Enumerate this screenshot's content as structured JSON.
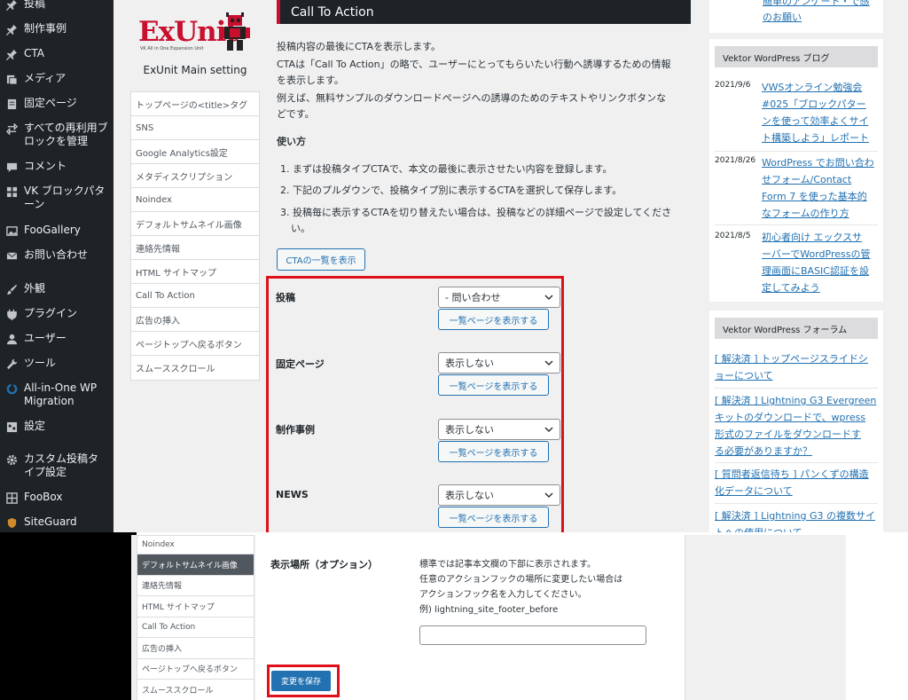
{
  "admin_menu": {
    "items": [
      {
        "label": "投稿",
        "icon": "pin-icon"
      },
      {
        "label": "制作事例",
        "icon": "pin-icon"
      },
      {
        "label": "CTA",
        "icon": "pin-icon"
      },
      {
        "label": "メディア",
        "icon": "media-icon"
      },
      {
        "label": "固定ページ",
        "icon": "page-icon"
      },
      {
        "label": "すべての再利用ブロックを管理",
        "icon": "reusable-block-icon"
      },
      {
        "label": "コメント",
        "icon": "comment-icon"
      },
      {
        "label": "VK ブロックパターン",
        "icon": "grid-icon"
      },
      {
        "label": "FooGallery",
        "icon": "gallery-icon"
      },
      {
        "label": "お問い合わせ",
        "icon": "mail-icon"
      },
      {
        "label": "外観",
        "icon": "brush-icon"
      },
      {
        "label": "プラグイン",
        "icon": "plugin-icon"
      },
      {
        "label": "ユーザー",
        "icon": "user-icon"
      },
      {
        "label": "ツール",
        "icon": "wrench-icon"
      },
      {
        "label": "All-in-One WP Migration",
        "icon": "migration-icon"
      },
      {
        "label": "設定",
        "icon": "settings-icon"
      },
      {
        "label": "カスタム投稿タイプ設定",
        "icon": "gear-icon"
      },
      {
        "label": "FooBox",
        "icon": "foobox-icon"
      },
      {
        "label": "SiteGuard",
        "icon": "shield-icon"
      }
    ]
  },
  "settings_nav": {
    "logo_text": "ExUnit",
    "logo_subtext": "VK All in One Expansion Unit",
    "title": "ExUnit Main setting",
    "items": [
      "トップページの<title>タグ",
      "SNS",
      "Google Analytics設定",
      "メタディスクリプション",
      "Noindex",
      "デフォルトサムネイル画像",
      "連絡先情報",
      "HTML サイトマップ",
      "Call To Action",
      "広告の挿入",
      "ページトップへ戻るボタン",
      "スムーススクロール"
    ]
  },
  "cta": {
    "header": "Call To Action",
    "desc1": "投稿内容の最後にCTAを表示します。",
    "desc2a": "CTAは「Call To Action」の略で、ユーザーにとってもらいたい行動へ誘導するための情報",
    "desc2b": "を表示します。",
    "desc3a": "例えば、無料サンプルのダウンロードページへの誘導のためのテキストやリンクボタンな",
    "desc3b": "どです。",
    "howto_title": "使い方",
    "step1": "1. まずは投稿タイプCTAで、本文の最後に表示させたい内容を登録します。",
    "step2": "2. 下記のプルダウンで、投稿タイプ別に表示するCTAを選択して保存します。",
    "step3a": "3. 投稿毎に表示するCTAを切り替えたい場合は、投稿などの詳細ページで設定してくださ",
    "step3b": "い。",
    "list_button": "CTAの一覧を表示",
    "rows": [
      {
        "label": "投稿",
        "selected": "- 問い合わせ",
        "button": "一覧ページを表示する"
      },
      {
        "label": "固定ページ",
        "selected": "表示しない",
        "button": "一覧ページを表示する"
      },
      {
        "label": "制作事例",
        "selected": "表示しない",
        "button": "一覧ページを表示する"
      },
      {
        "label": "NEWS",
        "selected": "表示しない",
        "button": "一覧ページを表示する"
      }
    ]
  },
  "sidebar": {
    "top_link_a": "簡単のアンケート・で感",
    "top_link_b": "のお願い",
    "blog_title": "Vektor WordPress ブログ",
    "blog": [
      {
        "date": "2021/9/6",
        "lines": [
          "VWSオンライン勉強会",
          "#025「ブロックパター",
          "ンを使って効率よくサイ",
          "ト構築しよう」レポート"
        ]
      },
      {
        "date": "2021/8/26",
        "lines": [
          "WordPress でお問い合わ",
          "せフォーム/Contact",
          "Form 7 を使った基本的",
          "なフォームの作り方"
        ]
      },
      {
        "date": "2021/8/5",
        "lines": [
          "初心者向け エックスサ",
          "ーバーでWordPressの管",
          "理画面にBASIC認証を設",
          "定してみよう"
        ]
      }
    ],
    "forum_title": "Vektor WordPress フォーラム",
    "forum": [
      [
        "[ 解決済 ] トップページスライドシ",
        "ョーについて"
      ],
      [
        "[ 解決済 ] Lightning G3 Evergreen",
        "キットのダウンロードで、wpress",
        "形式のファイルをダウンロードす",
        "る必要がありますか？"
      ],
      [
        "[ 質問者返信待ち ] パンくずの構造",
        "化データについて"
      ],
      [
        "[ 解決済 ] Lightning G3 の複数サイ",
        "トへの使用について"
      ]
    ]
  },
  "bottom": {
    "nav": [
      {
        "label": "Noindex",
        "active": false
      },
      {
        "label": "デフォルトサムネイル画像",
        "active": true
      },
      {
        "label": "連絡先情報",
        "active": false
      },
      {
        "label": "HTML サイトマップ",
        "active": false
      },
      {
        "label": "Call To Action",
        "active": false
      },
      {
        "label": "広告の挿入",
        "active": false
      },
      {
        "label": "ページトップへ戻るボタン",
        "active": false
      },
      {
        "label": "スムーススクロール",
        "active": false
      }
    ],
    "option_label": "表示場所（オプション）",
    "option_desc1": "標準では記事本文欄の下部に表示されます。",
    "option_desc2": "任意のアクションフックの場所に変更したい場合は",
    "option_desc3": "アクションフック名を入力してください。",
    "option_desc4": "例) lightning_site_footer_before",
    "option_input_value": "",
    "save_button": "変更を保存"
  },
  "colors": {
    "admin_bg": "#1d2327",
    "accent_blue": "#2271b1",
    "highlight_red": "#e0101a",
    "logo_red": "#c8102e"
  }
}
